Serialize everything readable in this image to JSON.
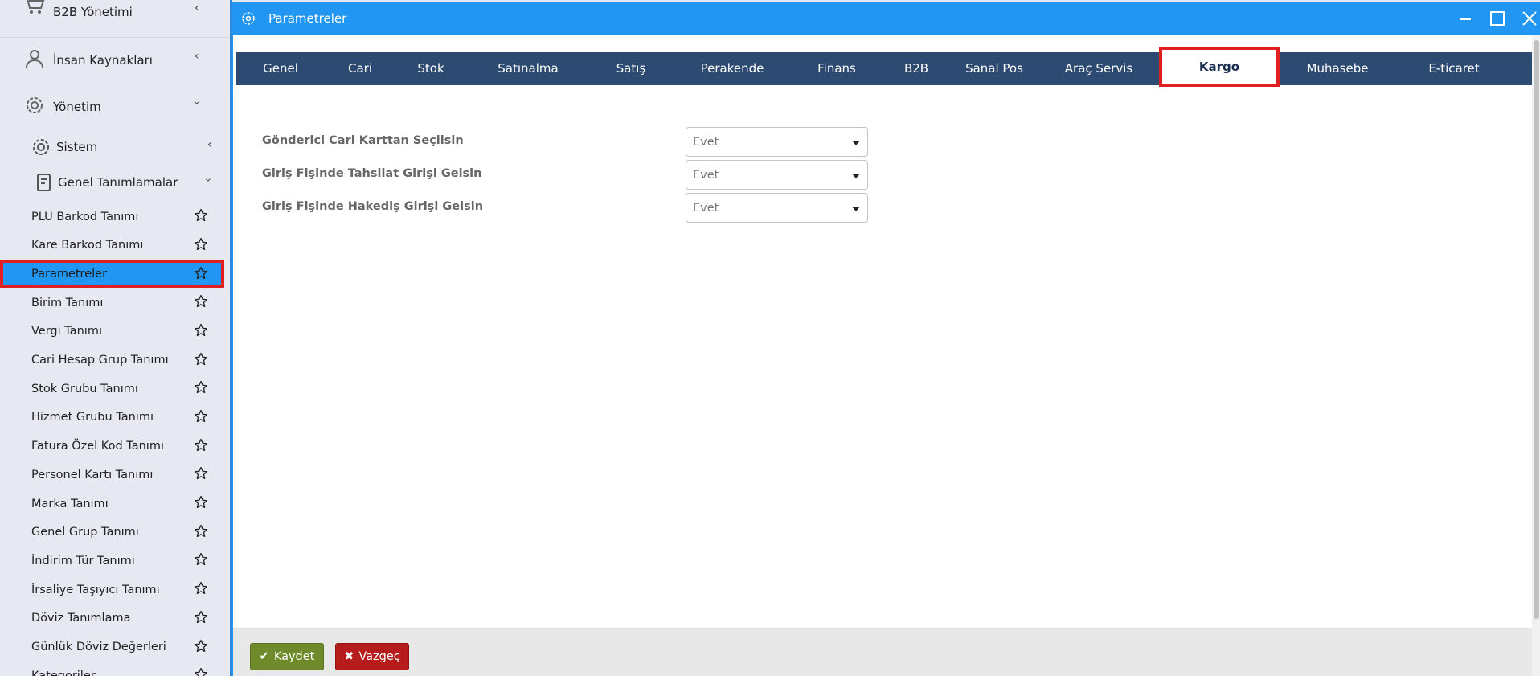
{
  "sidebar": {
    "top_items": [
      {
        "label": "B2B Yönetimi",
        "icon": "cart-icon"
      },
      {
        "label": "İnsan Kaynakları",
        "icon": "people-icon"
      },
      {
        "label": "Yönetim",
        "icon": "gear-cog-icon"
      }
    ],
    "sub_items": [
      {
        "label": "Sistem",
        "icon": "gear-icon"
      },
      {
        "label": "Genel Tanımlamalar",
        "icon": "document-icon"
      }
    ],
    "items": [
      {
        "label": "PLU Barkod Tanımı"
      },
      {
        "label": "Kare Barkod Tanımı"
      },
      {
        "label": "Parametreler"
      },
      {
        "label": "Birim Tanımı"
      },
      {
        "label": "Vergi Tanımı"
      },
      {
        "label": "Cari Hesap Grup Tanımı"
      },
      {
        "label": "Stok Grubu Tanımı"
      },
      {
        "label": "Hizmet Grubu Tanımı"
      },
      {
        "label": "Fatura Özel Kod Tanımı"
      },
      {
        "label": "Personel Kartı Tanımı"
      },
      {
        "label": "Marka Tanımı"
      },
      {
        "label": "Genel Grup Tanımı"
      },
      {
        "label": "İndirim Tür Tanımı"
      },
      {
        "label": "İrsaliye Taşıyıcı Tanımı"
      },
      {
        "label": "Döviz Tanımlama"
      },
      {
        "label": "Günlük Döviz Değerleri"
      },
      {
        "label": "Kategoriler"
      }
    ]
  },
  "window": {
    "title": "Parametreler"
  },
  "tabs": [
    {
      "label": "Genel"
    },
    {
      "label": "Cari"
    },
    {
      "label": "Stok"
    },
    {
      "label": "Satınalma"
    },
    {
      "label": "Satış"
    },
    {
      "label": "Perakende"
    },
    {
      "label": "Finans"
    },
    {
      "label": "B2B"
    },
    {
      "label": "Sanal Pos"
    },
    {
      "label": "Araç Servis"
    },
    {
      "label": "Kargo"
    },
    {
      "label": "Muhasebe"
    },
    {
      "label": "E-ticaret"
    }
  ],
  "active_tab": "Kargo",
  "form": [
    {
      "label": "Gönderici Cari Karttan Seçilsin",
      "value": "Evet"
    },
    {
      "label": "Giriş Fişinde Tahsilat Girişi Gelsin",
      "value": "Evet"
    },
    {
      "label": "Giriş Fişinde Hakediş Girişi Gelsin",
      "value": "Evet"
    }
  ],
  "footer": {
    "save_label": "Kaydet",
    "cancel_label": "Vazgeç"
  },
  "colors": {
    "accent": "#2196f3",
    "tabbar": "#2c4a72",
    "highlight": "#e02020",
    "save": "#6e8a2a",
    "cancel": "#b71c1c"
  }
}
